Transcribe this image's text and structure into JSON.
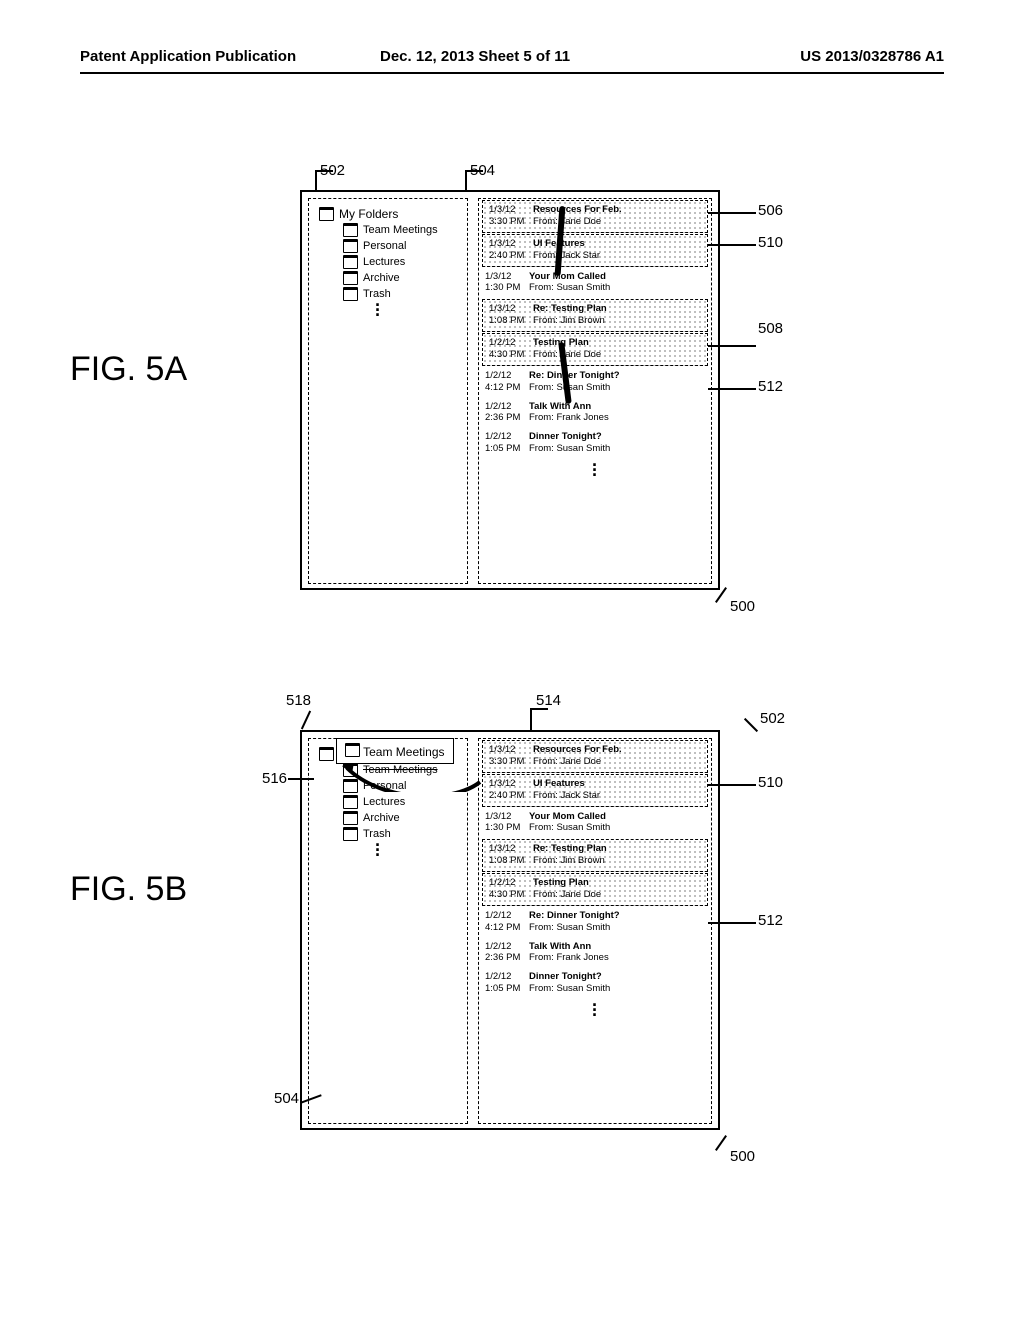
{
  "header": {
    "left": "Patent Application Publication",
    "mid": "Dec. 12, 2013  Sheet 5 of 11",
    "right": "US 2013/0328786 A1"
  },
  "figA": {
    "label": "FIG. 5A"
  },
  "figB": {
    "label": "FIG. 5B"
  },
  "folders": {
    "root": "My Folders",
    "items": [
      "Team Meetings",
      "Personal",
      "Lectures",
      "Archive",
      "Trash"
    ]
  },
  "messages": [
    {
      "date": "1/3/12",
      "time": "3:30 PM",
      "subject": "Resources For Feb.",
      "from": "From: Jane Doe",
      "hl": true
    },
    {
      "date": "1/3/12",
      "time": "2:40 PM",
      "subject": "UI Features",
      "from": "From: Jack Star",
      "hl": true
    },
    {
      "date": "1/3/12",
      "time": "1:30 PM",
      "subject": "Your Mom Called",
      "from": "From: Susan Smith",
      "hl": false
    },
    {
      "date": "1/3/12",
      "time": "1:08 PM",
      "subject": "Re: Testing Plan",
      "from": "From: Jim Brown",
      "hl": true
    },
    {
      "date": "1/2/12",
      "time": "4:30 PM",
      "subject": "Testing Plan",
      "from": "From: Jane Doe",
      "hl": true
    },
    {
      "date": "1/2/12",
      "time": "4:12 PM",
      "subject": "Re: Dinner Tonight?",
      "from": "From: Susan Smith",
      "hl": false
    },
    {
      "date": "1/2/12",
      "time": "2:36 PM",
      "subject": "Talk With Ann",
      "from": "From: Frank Jones",
      "hl": false
    },
    {
      "date": "1/2/12",
      "time": "1:05 PM",
      "subject": "Dinner Tonight?",
      "from": "From: Susan Smith",
      "hl": false
    }
  ],
  "refs": {
    "r500": "500",
    "r502": "502",
    "r504": "504",
    "r506": "506",
    "r508": "508",
    "r510": "510",
    "r512": "512",
    "r514": "514",
    "r516": "516",
    "r518": "518"
  },
  "popover": {
    "label": "Team Meetings"
  },
  "strikethrough": "Team Meetings"
}
